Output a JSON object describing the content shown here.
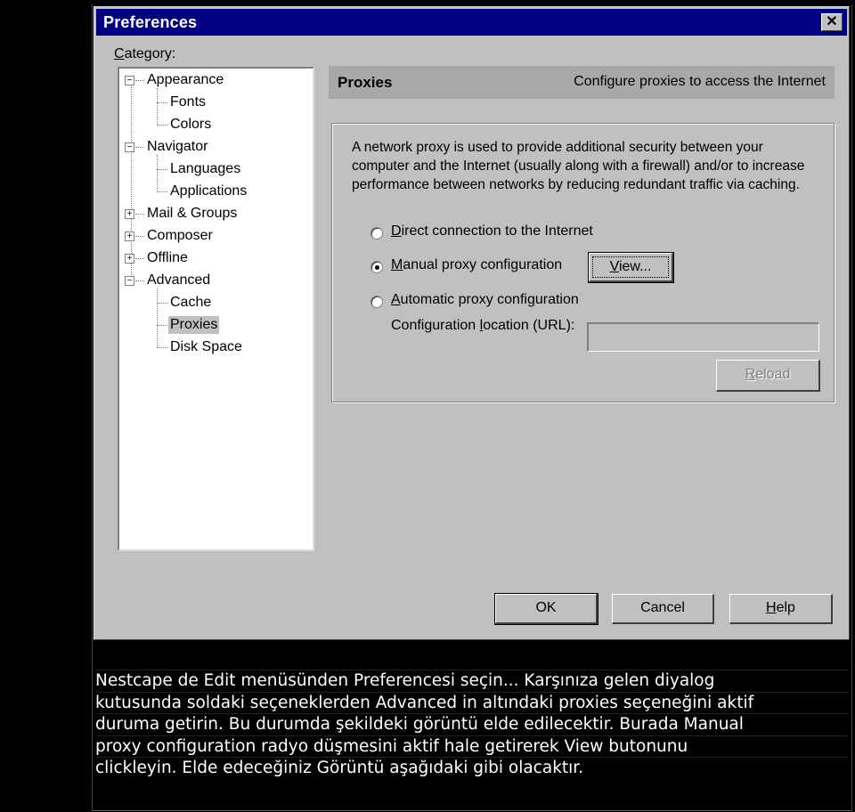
{
  "dialog": {
    "title": "Preferences",
    "close_icon": "close-icon",
    "category_label_prefix": "C",
    "category_label_rest": "ategory:",
    "tree": [
      {
        "label": "Appearance",
        "level": 0,
        "expander": "minus"
      },
      {
        "label": "Fonts",
        "level": 1
      },
      {
        "label": "Colors",
        "level": 1
      },
      {
        "label": "Navigator",
        "level": 0,
        "expander": "minus"
      },
      {
        "label": "Languages",
        "level": 1
      },
      {
        "label": "Applications",
        "level": 1
      },
      {
        "label": "Mail & Groups",
        "level": 0,
        "expander": "plus"
      },
      {
        "label": "Composer",
        "level": 0,
        "expander": "plus"
      },
      {
        "label": "Offline",
        "level": 0,
        "expander": "plus"
      },
      {
        "label": "Advanced",
        "level": 0,
        "expander": "minus"
      },
      {
        "label": "Cache",
        "level": 1
      },
      {
        "label": "Proxies",
        "level": 1,
        "selected": true
      },
      {
        "label": "Disk Space",
        "level": 1
      }
    ],
    "panel": {
      "title": "Proxies",
      "subtitle": "Configure proxies to access the Internet",
      "description": "A network proxy is used to provide additional security between your computer and the Internet (usually along with a firewall) and/or to increase performance between networks by reducing redundant traffic via caching.",
      "options": [
        {
          "accel": "D",
          "rest": "irect connection to the Internet",
          "checked": false
        },
        {
          "accel": "M",
          "rest": "anual proxy configuration",
          "checked": true
        },
        {
          "accel": "A",
          "rest": "utomatic proxy configuration",
          "checked": false
        }
      ],
      "view_button": {
        "accel": "V",
        "rest": "iew..."
      },
      "url_label": {
        "before": "Configuration ",
        "accel": "l",
        "after": "ocation (URL):"
      },
      "url_value": "",
      "reload_button": {
        "accel": "R",
        "rest": "eload",
        "disabled": true
      }
    },
    "footer": {
      "ok": "OK",
      "cancel": "Cancel",
      "help_accel": "H",
      "help_rest": "elp"
    }
  },
  "caption": {
    "lines": [
      "Nestcape de Edit menüsünden Preferencesi seçin... Karşınıza gelen diyalog",
      "kutusunda soldaki seçeneklerden Advanced in altındaki proxies seçeneğini aktif",
      "duruma getirin. Bu durumda şekildeki görüntü elde edilecektir. Burada Manual",
      "proxy configuration radyo düşmesini aktif hale getirerek View butonunu",
      "clickleyin. Elde edeceğiniz Görüntü aşağıdaki gibi olacaktır."
    ]
  }
}
